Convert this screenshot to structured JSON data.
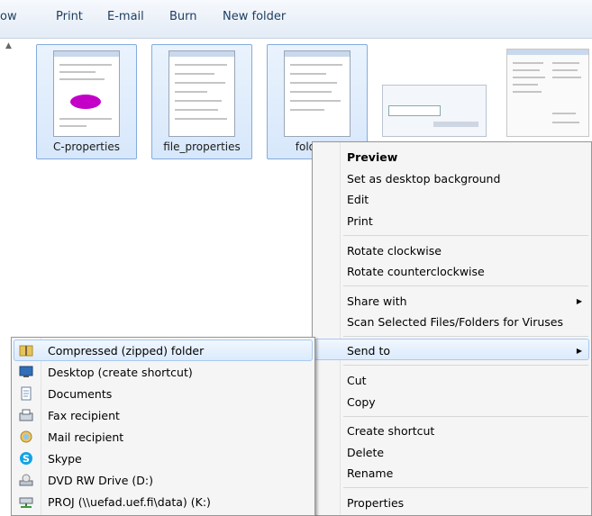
{
  "toolbar": {
    "items": [
      "ow",
      "Print",
      "E-mail",
      "Burn",
      "New folder"
    ]
  },
  "files": [
    {
      "name": "C-properties",
      "selected": true
    },
    {
      "name": "file_properties",
      "selected": true
    },
    {
      "name": "folder_p",
      "selected": true
    },
    {
      "name": "",
      "selected": false
    },
    {
      "name": "",
      "selected": false
    }
  ],
  "context_menu": {
    "items": [
      {
        "label": "Preview",
        "bold": true
      },
      {
        "label": "Set as desktop background"
      },
      {
        "label": "Edit"
      },
      {
        "label": "Print"
      },
      {
        "label": "Rotate clockwise"
      },
      {
        "label": "Rotate counterclockwise"
      },
      {
        "label": "Share with",
        "submenu": true
      },
      {
        "label": "Scan Selected Files/Folders for Viruses"
      },
      {
        "label": "Send to",
        "submenu": true,
        "highlighted": true
      },
      {
        "label": "Cut"
      },
      {
        "label": "Copy"
      },
      {
        "label": "Create shortcut"
      },
      {
        "label": "Delete"
      },
      {
        "label": "Rename"
      },
      {
        "label": "Properties"
      }
    ]
  },
  "send_to_menu": {
    "items": [
      {
        "label": "Compressed (zipped) folder",
        "icon": "zip-folder-icon",
        "highlighted": true
      },
      {
        "label": "Desktop (create shortcut)",
        "icon": "desktop-icon"
      },
      {
        "label": "Documents",
        "icon": "documents-icon"
      },
      {
        "label": "Fax recipient",
        "icon": "fax-icon"
      },
      {
        "label": "Mail recipient",
        "icon": "mail-icon"
      },
      {
        "label": "Skype",
        "icon": "skype-icon"
      },
      {
        "label": "DVD RW Drive (D:)",
        "icon": "dvd-drive-icon"
      },
      {
        "label": "PROJ (\\\\uefad.uef.fi\\data) (K:)",
        "icon": "network-drive-icon"
      }
    ]
  },
  "colors": {
    "selection": "#d7e7fb",
    "selection_border": "#84acdd",
    "menu_bg": "#f5f5f5",
    "highlight_border": "#a8c9ef"
  }
}
